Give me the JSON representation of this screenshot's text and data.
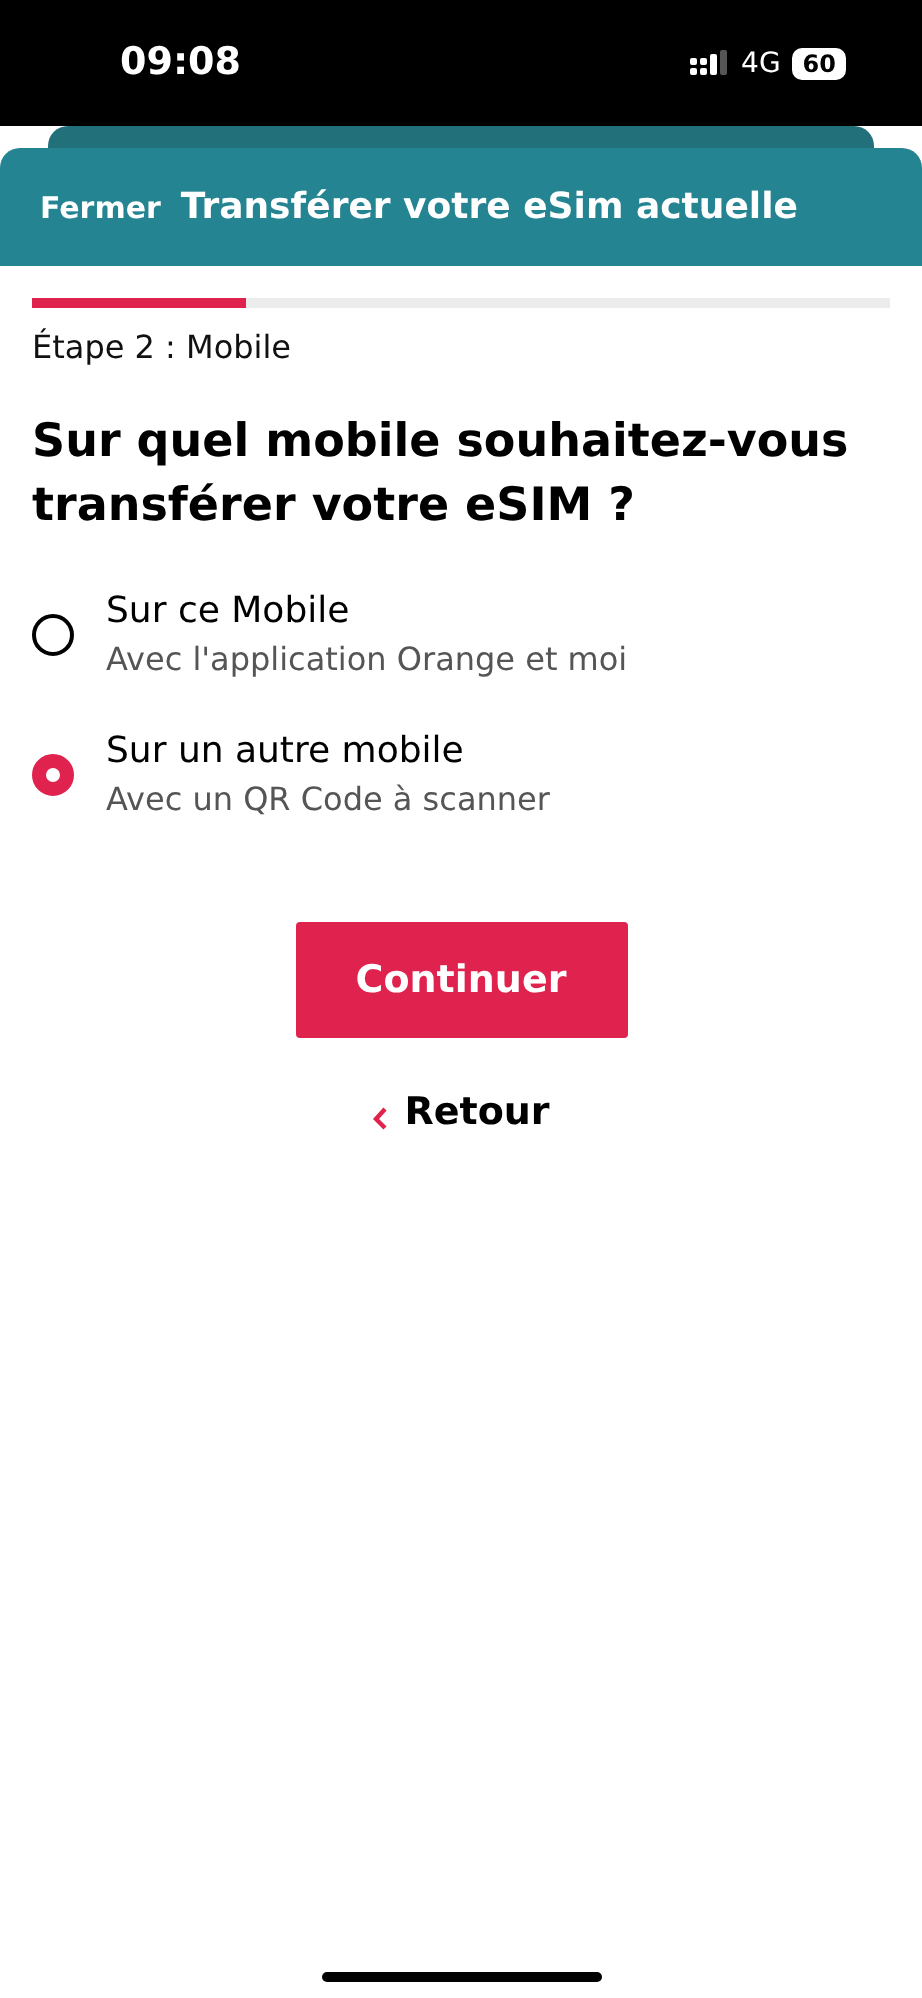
{
  "status_bar": {
    "time": "09:08",
    "network": "4G",
    "battery": "60"
  },
  "header": {
    "close": "Fermer",
    "title": "Transférer votre eSim actuelle"
  },
  "progress": {
    "level": 0.25
  },
  "step": "Étape 2 : Mobile",
  "question": "Sur quel mobile souhaitez-vous transférer votre eSIM ?",
  "options": [
    {
      "label": "Sur ce Mobile",
      "description": "Avec l'application Orange et moi",
      "selected": false
    },
    {
      "label": "Sur un autre mobile",
      "description": "Avec un QR Code à scanner",
      "selected": true
    }
  ],
  "primary_button": "Continuer",
  "back_link": "Retour"
}
